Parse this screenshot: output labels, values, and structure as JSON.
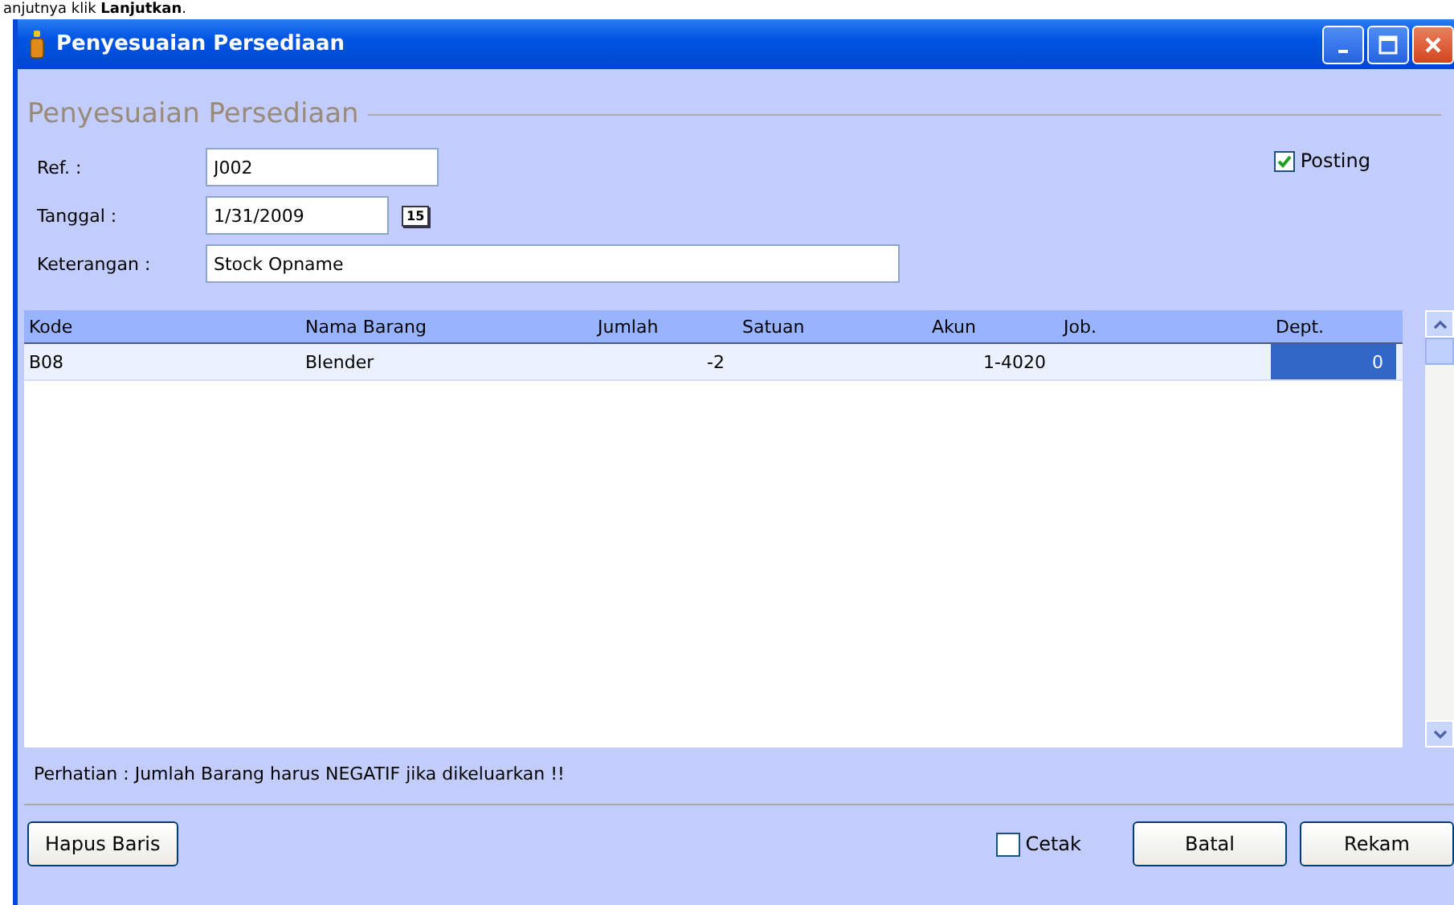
{
  "doc_text": "anjutnya klik **Lanjutkan**.",
  "window": {
    "title": "Penyesuaian Persediaan"
  },
  "group_title": "Penyesuaian Persediaan",
  "fields": [
    {
      "kind": "text",
      "label": "Ref. :",
      "value": "J002"
    },
    {
      "kind": "date",
      "label": "Tanggal :",
      "value": "1/31/2009",
      "button": "15"
    },
    {
      "kind": "wide",
      "label": "Keterangan :",
      "value": "Stock Opname"
    }
  ],
  "posting": {
    "label": "Posting",
    "checked": true
  },
  "table": {
    "columns": [
      {
        "label": "Kode"
      },
      {
        "label": "Nama Barang"
      },
      {
        "label": "Jumlah"
      },
      {
        "label": "Satuan"
      },
      {
        "label": "Akun"
      },
      {
        "label": "Job."
      },
      {
        "label": "Dept."
      }
    ],
    "rows": [
      {
        "cells": [
          {
            "text": "B08",
            "selected": false
          },
          {
            "text": "Blender",
            "selected": false
          },
          {
            "text": "-2",
            "selected": false
          },
          {
            "selected": false
          },
          {
            "text": "1-4020",
            "selected": false
          },
          {
            "selected": false
          },
          {
            "text": "0",
            "selected": true
          }
        ]
      }
    ]
  },
  "note": "Perhatian : Jumlah Barang harus NEGATIF jika dikeluarkan !!",
  "delete_button": "Hapus Baris",
  "print": {
    "label": "Cetak",
    "checked": false
  },
  "buttons": [
    "Batal",
    "Rekam"
  ]
}
